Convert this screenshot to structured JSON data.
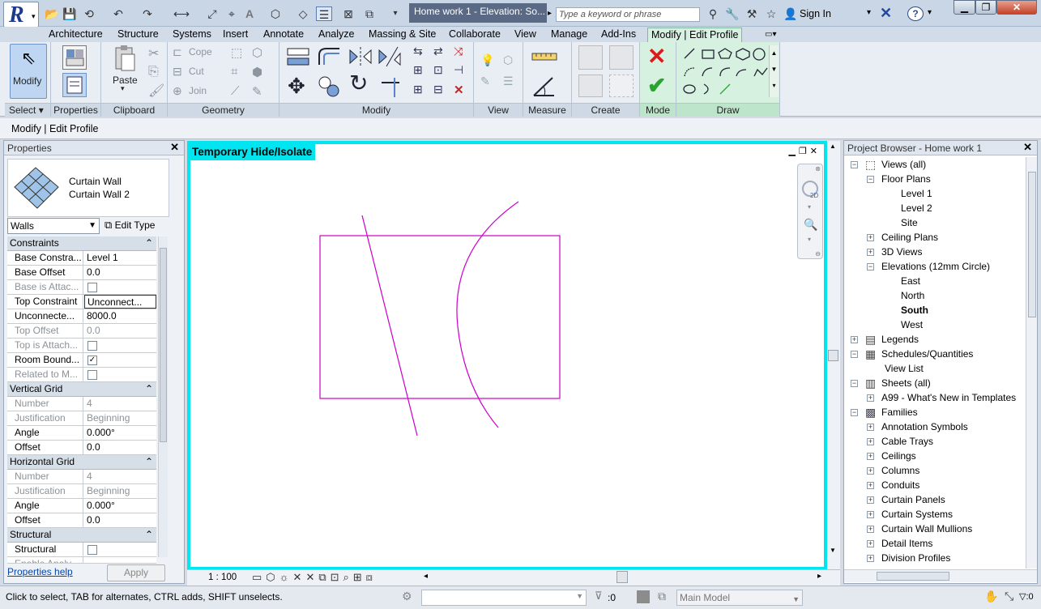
{
  "titlebar": {
    "logo_letter": "R",
    "document_title": "Home work 1 - Elevation: So...",
    "search_placeholder": "Type a keyword or phrase",
    "sign_in": "Sign In",
    "help": "?"
  },
  "ribbon_tabs": [
    "Architecture",
    "Structure",
    "Systems",
    "Insert",
    "Annotate",
    "Analyze",
    "Massing & Site",
    "Collaborate",
    "View",
    "Manage",
    "Add-Ins",
    "Modify | Edit Profile"
  ],
  "active_tab": "Modify | Edit Profile",
  "ribbon": {
    "modify_label": "Modify",
    "select_label": "Select",
    "properties_label": "Properties",
    "paste_label": "Paste",
    "clipboard_label": "Clipboard",
    "cope_label": "Cope",
    "cut_label": "Cut",
    "join_label": "Join",
    "geometry_label": "Geometry",
    "modify_panel_label": "Modify",
    "view_label": "View",
    "measure_label": "Measure",
    "create_label": "Create",
    "mode_label": "Mode",
    "draw_label": "Draw"
  },
  "context_bar": "Modify | Edit Profile",
  "properties": {
    "header": "Properties",
    "type_family": "Curtain Wall",
    "type_name": "Curtain Wall 2",
    "category_filter": "Walls",
    "edit_type": "Edit Type",
    "sections": {
      "constraints": "Constraints",
      "vertical_grid": "Vertical Grid",
      "horizontal_grid": "Horizontal Grid",
      "structural": "Structural"
    },
    "rows": {
      "base_constraint": {
        "key": "Base Constra...",
        "value": "Level 1"
      },
      "base_offset": {
        "key": "Base Offset",
        "value": "0.0"
      },
      "base_attached": {
        "key": "Base is Attac...",
        "value": ""
      },
      "top_constraint": {
        "key": "Top Constraint",
        "value": "Unconnect..."
      },
      "unconnected_height": {
        "key": "Unconnecte...",
        "value": "8000.0"
      },
      "top_offset": {
        "key": "Top Offset",
        "value": "0.0"
      },
      "top_attached": {
        "key": "Top is Attach...",
        "value": ""
      },
      "room_bounding": {
        "key": "Room Bound...",
        "value": "✓"
      },
      "related_mass": {
        "key": "Related to M...",
        "value": ""
      },
      "v_number": {
        "key": "Number",
        "value": "4"
      },
      "v_justification": {
        "key": "Justification",
        "value": "Beginning"
      },
      "v_angle": {
        "key": "Angle",
        "value": "0.000°"
      },
      "v_offset": {
        "key": "Offset",
        "value": "0.0"
      },
      "h_number": {
        "key": "Number",
        "value": "4"
      },
      "h_justification": {
        "key": "Justification",
        "value": "Beginning"
      },
      "h_angle": {
        "key": "Angle",
        "value": "0.000°"
      },
      "h_offset": {
        "key": "Offset",
        "value": "0.0"
      },
      "structural": {
        "key": "Structural",
        "value": ""
      },
      "enable_analytical": {
        "key": "Enable Analy...",
        "value": ""
      }
    },
    "help_link": "Properties help",
    "apply": "Apply"
  },
  "canvas": {
    "temp_label": "Temporary Hide/Isolate",
    "sketch_color": "#cc00cc",
    "border_color": "#00e5ef",
    "nav_2d": "2D"
  },
  "view_control_bar": {
    "scale": "1 : 100"
  },
  "project_browser": {
    "header": "Project Browser - Home work 1",
    "nodes": [
      {
        "label": "Views (all)",
        "expanded": true
      },
      {
        "label": "Floor Plans",
        "expanded": true
      },
      {
        "label": "Level 1"
      },
      {
        "label": "Level 2"
      },
      {
        "label": "Site"
      },
      {
        "label": "Ceiling Plans",
        "expanded": false
      },
      {
        "label": "3D Views",
        "expanded": false
      },
      {
        "label": "Elevations (12mm Circle)",
        "expanded": true
      },
      {
        "label": "East"
      },
      {
        "label": "North"
      },
      {
        "label": "South",
        "bold": true
      },
      {
        "label": "West"
      },
      {
        "label": "Legends",
        "expanded": false
      },
      {
        "label": "Schedules/Quantities",
        "expanded": true
      },
      {
        "label": "View List"
      },
      {
        "label": "Sheets (all)",
        "expanded": true
      },
      {
        "label": "A99 - What's New in Templates",
        "expanded": false
      },
      {
        "label": "Families",
        "expanded": true
      },
      {
        "label": "Annotation Symbols",
        "expanded": false
      },
      {
        "label": "Cable Trays",
        "expanded": false
      },
      {
        "label": "Ceilings",
        "expanded": false
      },
      {
        "label": "Columns",
        "expanded": false
      },
      {
        "label": "Conduits",
        "expanded": false
      },
      {
        "label": "Curtain Panels",
        "expanded": false
      },
      {
        "label": "Curtain Systems",
        "expanded": false
      },
      {
        "label": "Curtain Wall Mullions",
        "expanded": false
      },
      {
        "label": "Detail Items",
        "expanded": false
      },
      {
        "label": "Division Profiles",
        "expanded": false
      }
    ]
  },
  "status": {
    "message": "Click to select, TAB for alternates, CTRL adds, SHIFT unselects.",
    "selection_count": ":0",
    "model": "Main Model"
  }
}
